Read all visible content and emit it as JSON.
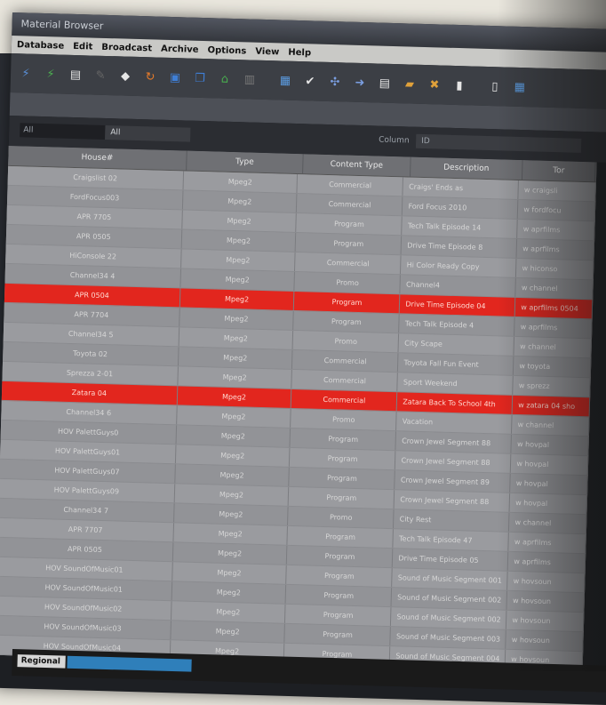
{
  "window": {
    "title": "Material Browser"
  },
  "menu": [
    "Database",
    "Edit",
    "Broadcast",
    "Archive",
    "Options",
    "View",
    "Help"
  ],
  "toolbar": [
    {
      "icon": "plug-icon",
      "color": "#5a8fd6"
    },
    {
      "icon": "plug-green-icon",
      "color": "#4caf50"
    },
    {
      "icon": "document-icon",
      "color": "#e6e6e6"
    },
    {
      "icon": "hammer-icon",
      "color": "#666666"
    },
    {
      "icon": "tag-icon",
      "color": "#e6e6e6"
    },
    {
      "icon": "refresh-icon",
      "color": "#e67b2a"
    },
    {
      "icon": "save-icon",
      "color": "#3f7fd6"
    },
    {
      "icon": "copy-icon",
      "color": "#3f7fd6"
    },
    {
      "icon": "home-icon",
      "color": "#49b04f"
    },
    {
      "icon": "paste-icon",
      "color": "#777777"
    },
    {
      "icon": "image-icon",
      "color": "#5b9be0"
    },
    {
      "icon": "check-icon",
      "color": "#e6e6e6"
    },
    {
      "icon": "network-icon",
      "color": "#7a9ee0"
    },
    {
      "icon": "arrow-icon",
      "color": "#7a9ee0"
    },
    {
      "icon": "page-icon",
      "color": "#e6e6e6"
    },
    {
      "icon": "folder-icon",
      "color": "#e0a13a"
    },
    {
      "icon": "tools-icon",
      "color": "#e0a13a"
    },
    {
      "icon": "book-icon",
      "color": "#e6e6e6"
    },
    {
      "icon": "file-icon",
      "color": "#e6e6e6"
    },
    {
      "icon": "grid-icon",
      "color": "#5b9be0"
    }
  ],
  "filters": {
    "type_value": "All",
    "class_value": "All",
    "column_label": "Column",
    "column_value": "ID"
  },
  "columns": [
    "House#",
    "Type",
    "Content Type",
    "Description",
    "Tor"
  ],
  "rows": [
    {
      "house": "Craigslist 02",
      "type": "Mpeg2",
      "ctype": "Commercial",
      "desc": "Craigs' Ends as",
      "tor": "w craigsli",
      "sel": false
    },
    {
      "house": "FordFocus003",
      "type": "Mpeg2",
      "ctype": "Commercial",
      "desc": "Ford Focus 2010",
      "tor": "w fordfocu",
      "sel": false
    },
    {
      "house": "APR 7705",
      "type": "Mpeg2",
      "ctype": "Program",
      "desc": "Tech Talk Episode 14",
      "tor": "w aprfilms",
      "sel": false
    },
    {
      "house": "APR 0505",
      "type": "Mpeg2",
      "ctype": "Program",
      "desc": "Drive Time Episode 8",
      "tor": "w aprfilms",
      "sel": false
    },
    {
      "house": "HiConsole 22",
      "type": "Mpeg2",
      "ctype": "Commercial",
      "desc": "Hi Color Ready Copy",
      "tor": "w hiconso",
      "sel": false
    },
    {
      "house": "Channel34 4",
      "type": "Mpeg2",
      "ctype": "Promo",
      "desc": "Channel4",
      "tor": "w channel",
      "sel": false
    },
    {
      "house": "APR 0504",
      "type": "Mpeg2",
      "ctype": "Program",
      "desc": "Drive Time Episode 04",
      "tor": "w aprfilms 0504",
      "sel": true
    },
    {
      "house": "APR 7704",
      "type": "Mpeg2",
      "ctype": "Program",
      "desc": "Tech Talk Episode 4",
      "tor": "w aprfilms",
      "sel": false
    },
    {
      "house": "Channel34 5",
      "type": "Mpeg2",
      "ctype": "Promo",
      "desc": "City Scape",
      "tor": "w channel",
      "sel": false
    },
    {
      "house": "Toyota 02",
      "type": "Mpeg2",
      "ctype": "Commercial",
      "desc": "Toyota Fall Fun Event",
      "tor": "w toyota",
      "sel": false
    },
    {
      "house": "Sprezza 2-01",
      "type": "Mpeg2",
      "ctype": "Commercial",
      "desc": "Sport Weekend",
      "tor": "w sprezz",
      "sel": false
    },
    {
      "house": "Zatara 04",
      "type": "Mpeg2",
      "ctype": "Commercial",
      "desc": "Zatara Back To School 4th",
      "tor": "w zatara 04 sho",
      "sel": true
    },
    {
      "house": "Channel34 6",
      "type": "Mpeg2",
      "ctype": "Promo",
      "desc": "Vacation",
      "tor": "w channel",
      "sel": false
    },
    {
      "house": "HOV PalettGuys0",
      "type": "Mpeg2",
      "ctype": "Program",
      "desc": "Crown Jewel Segment 88",
      "tor": "w hovpal",
      "sel": false
    },
    {
      "house": "HOV PalettGuys01",
      "type": "Mpeg2",
      "ctype": "Program",
      "desc": "Crown Jewel Segment 88",
      "tor": "w hovpal",
      "sel": false
    },
    {
      "house": "HOV PalettGuys07",
      "type": "Mpeg2",
      "ctype": "Program",
      "desc": "Crown Jewel Segment 89",
      "tor": "w hovpal",
      "sel": false
    },
    {
      "house": "HOV PalettGuys09",
      "type": "Mpeg2",
      "ctype": "Program",
      "desc": "Crown Jewel Segment 88",
      "tor": "w hovpal",
      "sel": false
    },
    {
      "house": "Channel34 7",
      "type": "Mpeg2",
      "ctype": "Promo",
      "desc": "City Rest",
      "tor": "w channel",
      "sel": false
    },
    {
      "house": "APR 7707",
      "type": "Mpeg2",
      "ctype": "Program",
      "desc": "Tech Talk Episode 47",
      "tor": "w aprfilms",
      "sel": false
    },
    {
      "house": "APR 0505",
      "type": "Mpeg2",
      "ctype": "Program",
      "desc": "Drive Time Episode 05",
      "tor": "w aprfilms",
      "sel": false
    },
    {
      "house": "HOV SoundOfMusic01",
      "type": "Mpeg2",
      "ctype": "Program",
      "desc": "Sound of Music Segment 001",
      "tor": "w hovsoun",
      "sel": false
    },
    {
      "house": "HOV SoundOfMusic01",
      "type": "Mpeg2",
      "ctype": "Program",
      "desc": "Sound of Music Segment 002",
      "tor": "w hovsoun",
      "sel": false
    },
    {
      "house": "HOV SoundOfMusic02",
      "type": "Mpeg2",
      "ctype": "Program",
      "desc": "Sound of Music Segment 002",
      "tor": "w hovsoun",
      "sel": false
    },
    {
      "house": "HOV SoundOfMusic03",
      "type": "Mpeg2",
      "ctype": "Program",
      "desc": "Sound of Music Segment 003",
      "tor": "w hovsoun",
      "sel": false
    },
    {
      "house": "HOV SoundOfMusic04",
      "type": "Mpeg2",
      "ctype": "Program",
      "desc": "Sound of Music Segment 004",
      "tor": "w hovsoun",
      "sel": false
    }
  ],
  "status": {
    "label": "Regional",
    "progress": 1.0
  }
}
